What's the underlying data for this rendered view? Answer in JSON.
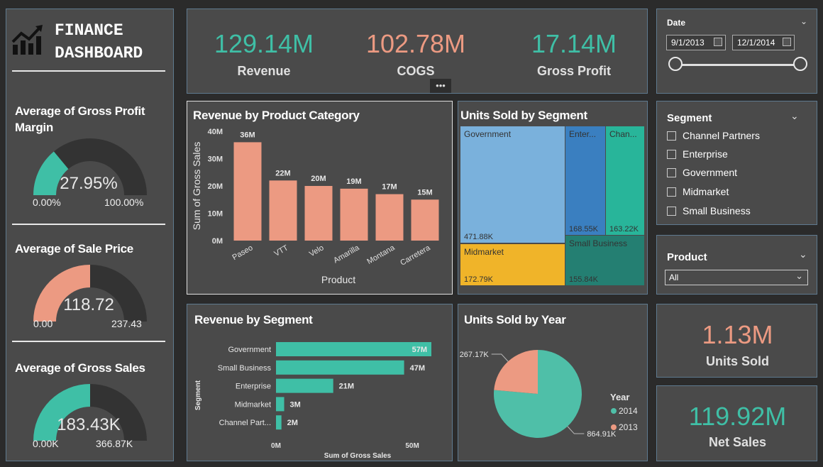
{
  "header": {
    "title_line1": "FINANCE",
    "title_line2": "DASHBOARD"
  },
  "colors": {
    "teal": "#3fbfa6",
    "salmon": "#ec9a82",
    "panel": "#4a4a4a",
    "gauge_track": "#333333"
  },
  "gauges": [
    {
      "title": "Average of Gross Profit Margin",
      "value_label": "27.95%",
      "min": "0.00%",
      "max": "100.00%",
      "fraction": 0.2795,
      "color": "#3fbfa6"
    },
    {
      "title": "Average of Sale Price",
      "value_label": "118.72",
      "min": "0.00",
      "max": "237.43",
      "fraction": 0.5,
      "color": "#ec9a82"
    },
    {
      "title": "Average of Gross Sales",
      "value_label": "183.43K",
      "min": "0.00K",
      "max": "366.87K",
      "fraction": 0.5,
      "color": "#3fbfa6"
    }
  ],
  "kpis": {
    "revenue": {
      "value": "129.14M",
      "label": "Revenue"
    },
    "cogs": {
      "value": "102.78M",
      "label": "COGS"
    },
    "gross_profit": {
      "value": "17.14M",
      "label": "Gross Profit"
    },
    "units_sold": {
      "value": "1.13M",
      "label": "Units Sold"
    },
    "net_sales": {
      "value": "119.92M",
      "label": "Net Sales"
    }
  },
  "more_options": "•••",
  "date_slicer": {
    "title": "Date",
    "start": "9/1/2013",
    "end": "12/1/2014"
  },
  "segment_slicer": {
    "title": "Segment",
    "items": [
      "Channel Partners",
      "Enterprise",
      "Government",
      "Midmarket",
      "Small Business"
    ]
  },
  "product_slicer": {
    "title": "Product",
    "selected": "All"
  },
  "treemap": {
    "title": "Units Sold by Segment",
    "cells": [
      {
        "name": "Government",
        "value": "471.88K",
        "color": "#7ab1dc"
      },
      {
        "name": "Midmarket",
        "value": "172.79K",
        "color": "#f0b429"
      },
      {
        "name": "Enter...",
        "value": "168.55K",
        "color": "#3a7fc0"
      },
      {
        "name": "Chan...",
        "value": "163.22K",
        "color": "#28b59a"
      },
      {
        "name": "Small Business",
        "value": "155.84K",
        "color": "#247f72"
      }
    ]
  },
  "chart_data": [
    {
      "type": "bar",
      "title": "Revenue by Product Category",
      "xlabel": "Product",
      "ylabel": "Sum of Gross Sales",
      "categories": [
        "Paseo",
        "VTT",
        "Velo",
        "Amarilla",
        "Montana",
        "Carretera"
      ],
      "values": [
        36,
        22,
        20,
        19,
        17,
        15
      ],
      "data_labels": [
        "36M",
        "22M",
        "20M",
        "19M",
        "17M",
        "15M"
      ],
      "yticks": [
        "0M",
        "10M",
        "20M",
        "30M",
        "40M"
      ],
      "ylim": [
        0,
        40
      ],
      "color": "#ec9a82"
    },
    {
      "type": "bar",
      "orientation": "horizontal",
      "title": "Revenue by Segment",
      "xlabel": "Sum of Gross Sales",
      "ylabel": "Segment",
      "categories": [
        "Government",
        "Small Business",
        "Enterprise",
        "Midmarket",
        "Channel Part..."
      ],
      "values": [
        57,
        47,
        21,
        3,
        2
      ],
      "data_labels": [
        "57M",
        "47M",
        "21M",
        "3M",
        "2M"
      ],
      "xticks": [
        "0M",
        "50M"
      ],
      "xlim": [
        0,
        57
      ],
      "color": "#3fbfa6"
    },
    {
      "type": "pie",
      "title": "Units Sold by Year",
      "legend_title": "Year",
      "legend_position": "right",
      "slices": [
        {
          "label": "2014",
          "value": 864.91,
          "display": "864.91K",
          "color": "#4fbfa8"
        },
        {
          "label": "2013",
          "value": 267.17,
          "display": "267.17K",
          "color": "#ec9a82"
        }
      ]
    }
  ]
}
